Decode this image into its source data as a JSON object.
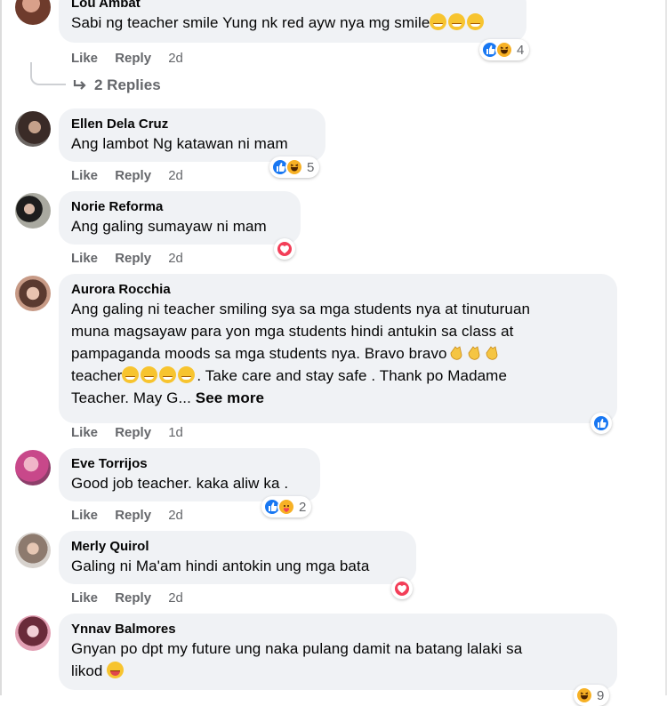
{
  "labels": {
    "like": "Like",
    "reply": "Reply",
    "see_more": "See more"
  },
  "comments": [
    {
      "name": "Lou Ambat",
      "text": "Sabi ng teacher smile Yung nk red ayw nya mg smile",
      "emojis": [
        "grin-emoji",
        "grin-emoji",
        "grin-emoji"
      ],
      "time": "2d",
      "reactions": [
        "like",
        "laugh"
      ],
      "reaction_count": "4",
      "replies": "2 Replies"
    },
    {
      "name": "Ellen Dela Cruz",
      "text": "Ang lambot Ng katawan ni mam",
      "time": "2d",
      "reactions": [
        "like",
        "laugh"
      ],
      "reaction_count": "5"
    },
    {
      "name": "Norie Reforma",
      "text": "Ang galing sumayaw ni mam",
      "time": "2d",
      "reactions": [
        "love"
      ],
      "reaction_count": ""
    },
    {
      "name": "Aurora Rocchia",
      "lines": [
        "Ang galing ni teacher smiling sya sa mga students nya at tinuturuan",
        "muna magsayaw para yon mga students hindi antukin sa class at",
        "pampaganda moods sa mga students nya. Bravo bravo",
        "teacher",
        ". Take care and stay safe . Thank po Madame",
        "Teacher. May G..."
      ],
      "time": "1d",
      "reactions": [
        "like"
      ],
      "reaction_count": ""
    },
    {
      "name": "Eve Torrijos",
      "text": "Good job teacher. kaka aliw ka .",
      "time": "2d",
      "reactions": [
        "like",
        "care"
      ],
      "reaction_count": "2"
    },
    {
      "name": "Merly Quirol",
      "text": "Galing ni Ma'am hindi antokin ung mga bata",
      "time": "2d",
      "reactions": [
        "love"
      ],
      "reaction_count": ""
    },
    {
      "name": "Ynnav Balmores",
      "lines": [
        "Gnyan po dpt my future ung naka pulang damit na batang lalaki sa",
        "likod"
      ],
      "reactions": [
        "laugh"
      ],
      "reaction_count": "9"
    }
  ],
  "colors": {
    "bubble": "#f0f2f5",
    "meta": "#65676b",
    "like_blue": "#1877f2",
    "love_red": "#f33e58",
    "emoji_yellow": "#f7c42f"
  }
}
